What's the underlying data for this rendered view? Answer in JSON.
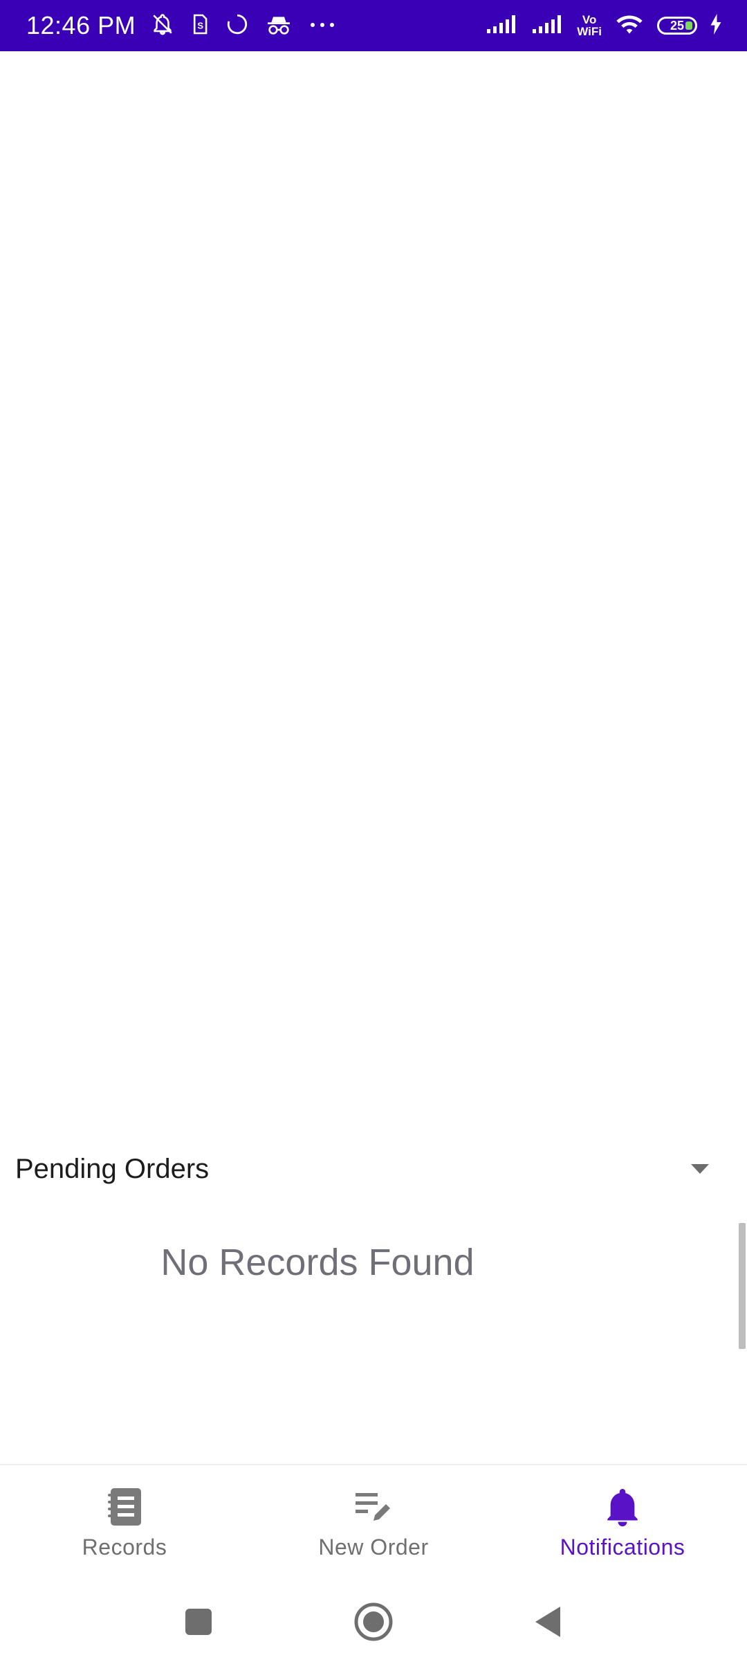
{
  "status_bar": {
    "time": "12:46 PM",
    "vowifi_top": "Vo",
    "vowifi_bottom": "WiFi",
    "battery_level": "25",
    "background_color": "#3a00b5",
    "icons_left": [
      "bell-off-icon",
      "sim-icon",
      "loading-icon",
      "incognito-icon",
      "more-icon"
    ],
    "icons_right": [
      "signal-icon",
      "signal-icon",
      "vowifi-icon",
      "wifi-icon",
      "battery-icon",
      "charging-icon"
    ]
  },
  "section": {
    "title": "Pending Orders",
    "dropdown_icon": "caret-down-icon",
    "empty_message": "No Records Found"
  },
  "bottom_nav": {
    "items": [
      {
        "label": "Records",
        "icon": "notebook-icon",
        "active": false
      },
      {
        "label": "New Order",
        "icon": "edit-list-icon",
        "active": false
      },
      {
        "label": "Notifications",
        "icon": "bell-icon",
        "active": true
      }
    ],
    "active_color": "#5a12c6",
    "inactive_color": "#6f6f6f"
  },
  "system_nav": {
    "buttons": [
      "recents-button",
      "home-button",
      "back-button"
    ]
  }
}
